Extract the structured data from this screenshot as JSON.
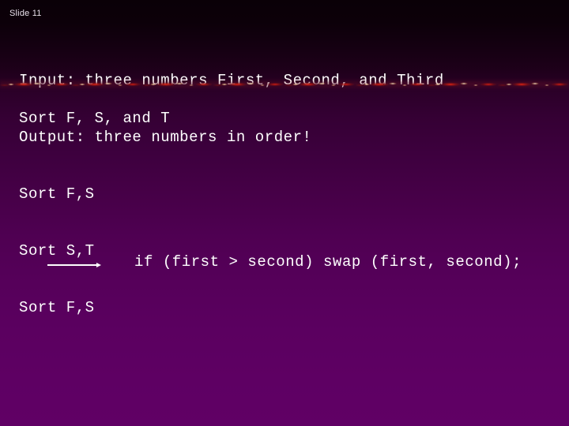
{
  "slide": {
    "label": "Slide 11",
    "background": {
      "top_color": "#0a0007",
      "mid_color": "#3e003f",
      "bottom_color": "#600065"
    },
    "text_color": "#ffffff"
  },
  "io_block": {
    "lines": [
      "Input: three numbers First, Second, and Third",
      "Output: three numbers in order!"
    ]
  },
  "divider": {
    "name": "flame-divider",
    "accent_color": "#e82412",
    "spark_color": "#fff8e1"
  },
  "sort_main": {
    "text": "Sort F, S, and T"
  },
  "sort_steps": {
    "lines": [
      "Sort F,S",
      "Sort S,T",
      "Sort F,S"
    ]
  },
  "code": {
    "line": "if (first > second) swap (first, second);"
  },
  "arrow": {
    "name": "right-arrow",
    "color": "#ffffff"
  }
}
